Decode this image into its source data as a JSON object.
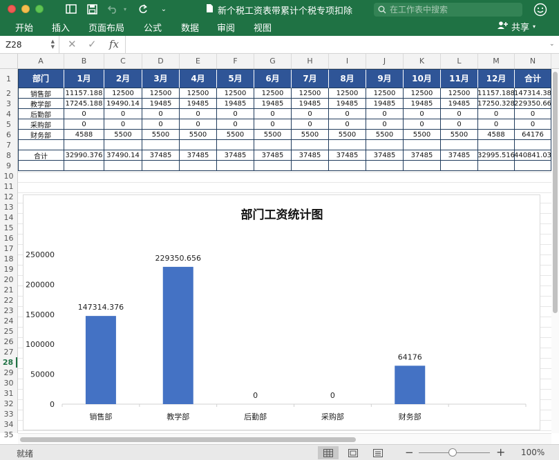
{
  "window": {
    "title": "新个税工资表带累计个税专项扣除",
    "search_placeholder": "在工作表中搜索"
  },
  "ribbon": {
    "tabs": [
      "开始",
      "插入",
      "页面布局",
      "公式",
      "数据",
      "审阅",
      "视图"
    ],
    "share_label": "共享"
  },
  "formula_bar": {
    "name_box": "Z28",
    "fx_label": "fx",
    "formula": ""
  },
  "grid": {
    "columns": [
      "A",
      "B",
      "C",
      "D",
      "E",
      "F",
      "G",
      "H",
      "I",
      "J",
      "K",
      "L",
      "M",
      "N"
    ],
    "rows": [
      "1",
      "2",
      "3",
      "4",
      "5",
      "6",
      "7",
      "8",
      "9",
      "10",
      "11",
      "12",
      "13",
      "14",
      "15",
      "16",
      "17",
      "18",
      "19",
      "20",
      "21",
      "22",
      "23",
      "24",
      "25",
      "26",
      "27",
      "28",
      "29",
      "30",
      "31",
      "32",
      "33",
      "34",
      "35"
    ],
    "active_row": "28"
  },
  "table": {
    "headers": [
      "部门",
      "1月",
      "2月",
      "3月",
      "4月",
      "5月",
      "6月",
      "7月",
      "8月",
      "9月",
      "10月",
      "11月",
      "12月",
      "合计"
    ],
    "rows": [
      [
        "销售部",
        "11157.188",
        "12500",
        "12500",
        "12500",
        "12500",
        "12500",
        "12500",
        "12500",
        "12500",
        "12500",
        "12500",
        "11157.188",
        "147314.38"
      ],
      [
        "教学部",
        "17245.188",
        "19490.14",
        "19485",
        "19485",
        "19485",
        "19485",
        "19485",
        "19485",
        "19485",
        "19485",
        "19485",
        "17250.328",
        "229350.66"
      ],
      [
        "后勤部",
        "0",
        "0",
        "0",
        "0",
        "0",
        "0",
        "0",
        "0",
        "0",
        "0",
        "0",
        "0",
        "0"
      ],
      [
        "采购部",
        "0",
        "0",
        "0",
        "0",
        "0",
        "0",
        "0",
        "0",
        "0",
        "0",
        "0",
        "0",
        "0"
      ],
      [
        "财务部",
        "4588",
        "5500",
        "5500",
        "5500",
        "5500",
        "5500",
        "5500",
        "5500",
        "5500",
        "5500",
        "5500",
        "4588",
        "64176"
      ],
      [
        "",
        "",
        "",
        "",
        "",
        "",
        "",
        "",
        "",
        "",
        "",
        "",
        "",
        ""
      ],
      [
        "合计",
        "32990.376",
        "37490.14",
        "37485",
        "37485",
        "37485",
        "37485",
        "37485",
        "37485",
        "37485",
        "37485",
        "37485",
        "32995.516",
        "440841.03"
      ],
      [
        "",
        "",
        "",
        "",
        "",
        "",
        "",
        "",
        "",
        "",
        "",
        "",
        "",
        ""
      ]
    ]
  },
  "chart_data": {
    "type": "bar",
    "title": "部门工资统计图",
    "categories": [
      "销售部",
      "教学部",
      "后勤部",
      "采购部",
      "财务部"
    ],
    "values": [
      147314.376,
      229350.656,
      0,
      0,
      64176
    ],
    "data_labels": [
      "147314.376",
      "229350.656",
      "0",
      "0",
      "64176"
    ],
    "y_ticks": [
      "0",
      "50000",
      "100000",
      "150000",
      "200000",
      "250000"
    ],
    "ylim": [
      0,
      250000
    ],
    "xlabel": "",
    "ylabel": "",
    "grid": false,
    "bar_color": "#4472c4"
  },
  "status_bar": {
    "ready_text": "就绪",
    "zoom_level": "100%"
  },
  "colors": {
    "ribbon_green": "#1f7244",
    "table_header": "#2f5597",
    "bar": "#4472c4"
  }
}
